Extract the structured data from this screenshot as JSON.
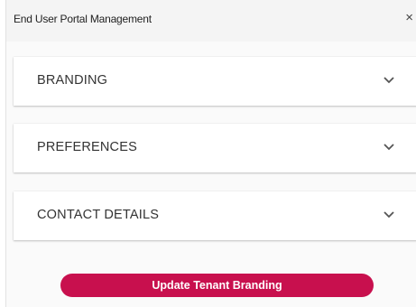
{
  "dialog": {
    "title": "End User Portal Management",
    "close_symbol": "×"
  },
  "sections": [
    {
      "label": "BRANDING",
      "icon": "chevron-down-icon"
    },
    {
      "label": "PREFERENCES",
      "icon": "chevron-down-icon"
    },
    {
      "label": "CONTACT DETAILS",
      "icon": "chevron-down-icon"
    }
  ],
  "actions": {
    "update_label": "Update Tenant Branding"
  },
  "colors": {
    "accent": "#c8104e",
    "panel_bg": "#ffffff",
    "header_bg": "#f4f4f4"
  }
}
